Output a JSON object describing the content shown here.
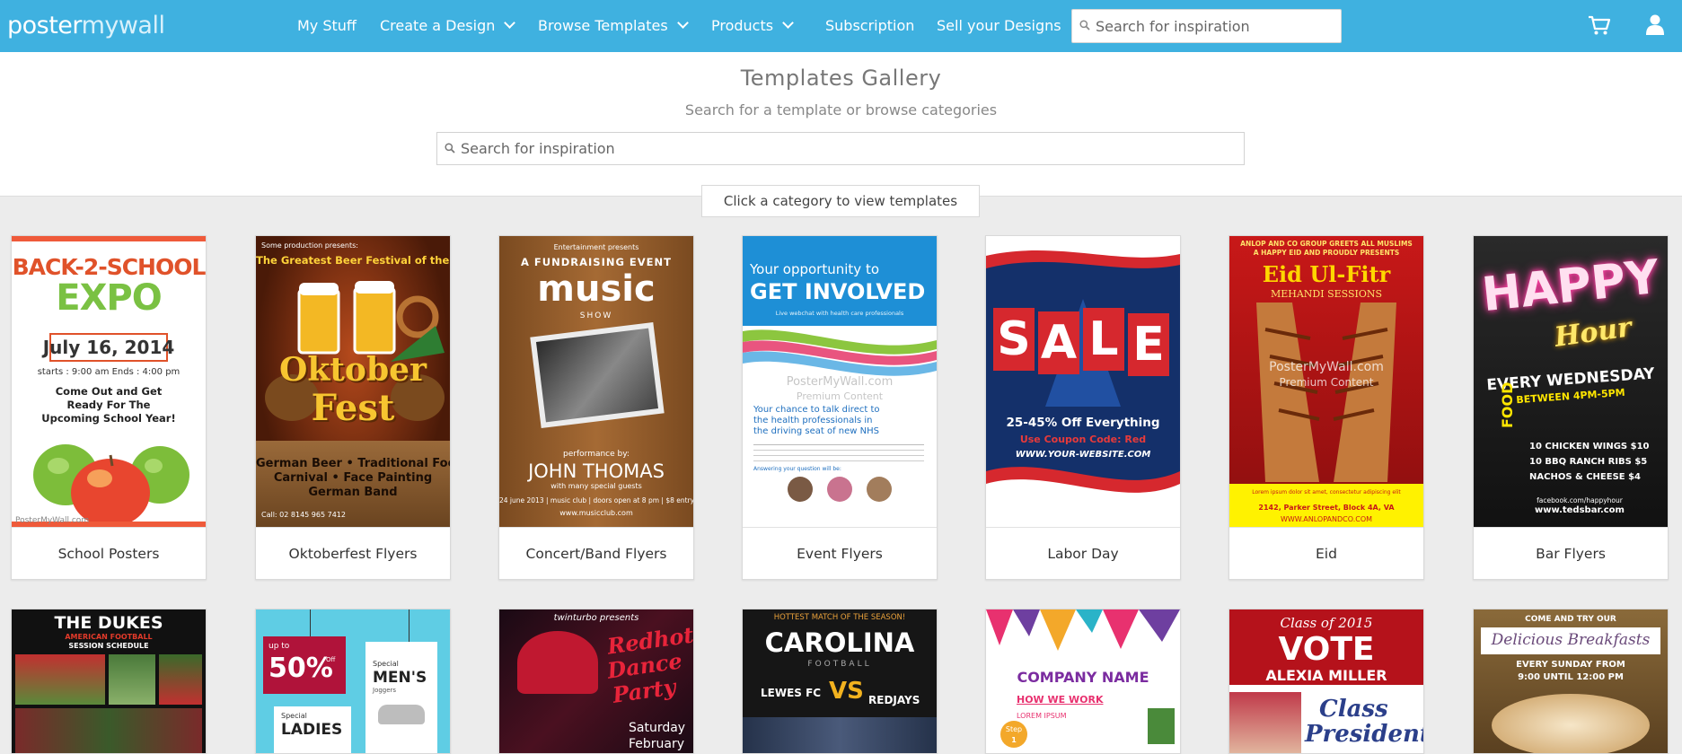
{
  "brand": {
    "part1": "poster",
    "part2": "mywall"
  },
  "nav": {
    "my_stuff": "My Stuff",
    "create": "Create a Design",
    "browse": "Browse Templates",
    "products": "Products",
    "subscription": "Subscription",
    "sell": "Sell your Designs",
    "search_placeholder": "Search for inspiration"
  },
  "icons": {
    "search": "search-icon",
    "cart": "cart-icon",
    "user": "user-icon",
    "chevron": "chevron-down-icon"
  },
  "gallery": {
    "title": "Templates Gallery",
    "subtitle": "Search for a template or browse categories",
    "search_placeholder": "Search for inspiration",
    "category_hint": "Click a category to view templates"
  },
  "colors": {
    "accent": "#3fb1e0"
  },
  "categories": [
    {
      "label": "School Posters"
    },
    {
      "label": "Oktoberfest Flyers"
    },
    {
      "label": "Concert/Band Flyers"
    },
    {
      "label": "Event Flyers"
    },
    {
      "label": "Labor Day"
    },
    {
      "label": "Eid"
    },
    {
      "label": "Bar Flyers"
    }
  ],
  "thumbs": {
    "school": {
      "l1": "BACK-2-SCHOOL",
      "l2": "EXPO",
      "date": "July 16, 2014",
      "times": "starts : 9:00 am  Ends : 4:00 pm",
      "body": "Come Out and Get Ready For The Upcoming School Year!",
      "wm": "PosterMyWall.com"
    },
    "okto": {
      "pre": "Some production presents:",
      "tag": "The Greatest Beer Festival of the World",
      "word1": "Oktober",
      "word2": "Fest",
      "line1": "German Beer • Traditional Food",
      "line2": "Carnival • Face Painting",
      "line3": "German Band",
      "call": "Call: 02 8145 965 7412"
    },
    "music": {
      "pre": "Entertainment presents",
      "tag": "A FUNDRAISING EVENT",
      "word": "music",
      "show": "SHOW",
      "perf": "performance by:",
      "name": "JOHN THOMAS",
      "guests": "with many special guests",
      "date": "24 june 2013  |  music club  |  doors open at 8 pm  |  $8 entry",
      "url": "www.musicclub.com"
    },
    "event": {
      "l1": "Your opportunity to",
      "l2": "GET INVOLVED",
      "l3": "Live webchat with health care professionals",
      "wm1": "PosterMyWall.com",
      "wm2": "Premium Content",
      "b1": "Your chance to talk direct to",
      "b2": "the health professionals in",
      "b3": "the driving seat of new NHS",
      "q": "Answering your question will be:"
    },
    "labor": {
      "letters": [
        "S",
        "A",
        "L",
        "E"
      ],
      "off": "25-45% Off Everything",
      "code": "Use Coupon Code: Red",
      "site": "WWW.YOUR-WEBSITE.COM"
    },
    "eid": {
      "top1": "ANLOP AND CO GROUP GREETS ALL MUSLIMS",
      "top2": "A HAPPY EID AND PROUDLY PRESENTS",
      "title": "Eid Ul-Fitr",
      "sub": "MEHANDI SESSIONS",
      "wm1": "PosterMyWall.com",
      "wm2": "Premium Content",
      "addr": "2142, Parker Street, Block 4A, VA",
      "site": "WWW.ANLOPANDCO.COM"
    },
    "bar": {
      "w1": "HAPPY",
      "w2": "Hour",
      "day": "EVERY WEDNESDAY",
      "time": "BETWEEN 4PM-5PM",
      "food": "FOOD",
      "i1": "10 CHICKEN WINGS $10",
      "i2": "10 BBQ RANCH RIBS $5",
      "i3": "NACHOS & CHEESE $4",
      "fb": "facebook.com/happyhour",
      "site": "www.tedsbar.com"
    },
    "dukes": {
      "t1": "THE DUKES",
      "t2": "AMERICAN FOOTBALL",
      "t3": "SESSION SCHEDULE"
    },
    "sale": {
      "upto": "up to",
      "pct": "50%",
      "off": "Off",
      "special": "Special",
      "mens": "MEN'S",
      "joggers": "Joggers",
      "special2": "Special",
      "ladies": "LADIES"
    },
    "dance": {
      "pre": "twinturbo presents",
      "l1": "Redhot",
      "l2": "Dance",
      "l3": "Party",
      "sat": "Saturday",
      "feb": "February"
    },
    "carolina": {
      "pre": "HOTTEST MATCH OF THE SEASON!",
      "title": "CAROLINA",
      "fb": "FOOTBALL",
      "a": "LEWES FC",
      "vs": "VS",
      "b": "REDJAYS"
    },
    "company": {
      "name": "COMPANY NAME",
      "how": "HOW WE WORK",
      "lorem": "LOREM IPSUM",
      "step": "Step",
      "one": "1"
    },
    "vote": {
      "cls": "Class of 2015",
      "vote": "VOTE",
      "name": "ALEXIA MILLER",
      "c1": "Class",
      "c2": "President"
    },
    "breakfast": {
      "pre": "COME AND TRY OUR",
      "title": "Delicious Breakfasts",
      "when": "EVERY SUNDAY FROM",
      "hrs": "9:00 UNTIL 12:00 PM"
    }
  }
}
